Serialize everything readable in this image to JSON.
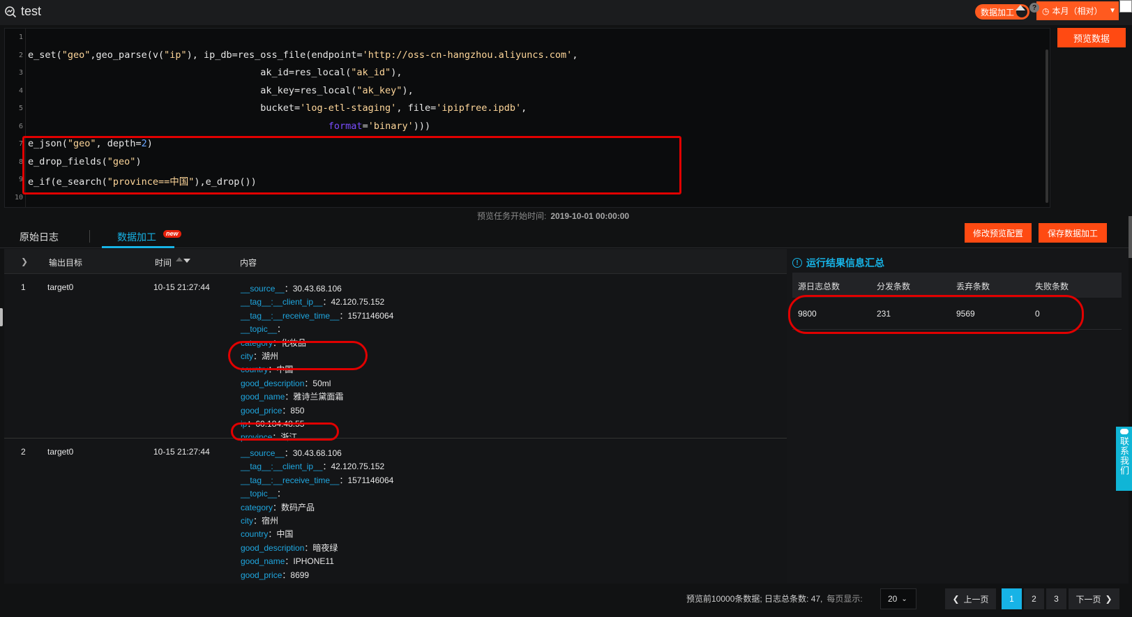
{
  "app": {
    "title": "test"
  },
  "header": {
    "toggle_label": "数据加工",
    "time_range": "本月（相对）",
    "preview_button": "预览数据"
  },
  "editor": {
    "lines": [
      {
        "n": "1",
        "html": ""
      },
      {
        "n": "2",
        "html": "e_set(<span class='str'>\"geo\"</span>,geo_parse(v(<span class='str'>\"ip\"</span>), ip_db=res_oss_file(endpoint=<span class='str'>'http://oss-cn-hangzhou.aliyuncs.com'</span>,"
      },
      {
        "n": "3",
        "html": "                                         ak_id=res_local(<span class='str'>\"ak_id\"</span>),"
      },
      {
        "n": "4",
        "html": "                                         ak_key=res_local(<span class='str'>\"ak_key\"</span>),"
      },
      {
        "n": "5",
        "html": "                                         bucket=<span class='str'>'log-etl-staging'</span>, file=<span class='str'>'ipipfree.ipdb'</span>,"
      },
      {
        "n": "6",
        "html": "                                                     <span class='kw'>format</span>=<span class='str'>'binary'</span>)))"
      },
      {
        "n": "7",
        "html": "e_json(<span class='str'>\"geo\"</span>, depth=<span class='num'>2</span>)"
      },
      {
        "n": "8",
        "html": "e_drop_fields(<span class='str'>\"geo\"</span>)"
      },
      {
        "n": "9",
        "html": "e_if(e_search(<span class='str'>\"province==中国\"</span>),e_drop())"
      },
      {
        "n": "10",
        "html": ""
      }
    ],
    "preview_time_label": "预览任务开始时间:",
    "preview_time_value": "2019-10-01 00:00:00"
  },
  "tabs": {
    "raw_log": "原始日志",
    "processing": "数据加工",
    "new_badge": "new",
    "modify_config": "修改预览配置",
    "save_processing": "保存数据加工"
  },
  "table": {
    "headers": {
      "target": "输出目标",
      "time": "时间",
      "content": "内容"
    },
    "rows": [
      {
        "index": "1",
        "target": "target0",
        "time": "10-15 21:27:44",
        "fields": [
          {
            "k": "__source__",
            "v": "30.43.68.106"
          },
          {
            "k": "__tag__:__client_ip__",
            "v": "42.120.75.152"
          },
          {
            "k": "__tag__:__receive_time__",
            "v": "1571146064"
          },
          {
            "k": "__topic__",
            "v": ""
          },
          {
            "k": "category",
            "v": "化妆品"
          },
          {
            "k": "city",
            "v": "湖州"
          },
          {
            "k": "country",
            "v": "中国"
          },
          {
            "k": "good_description",
            "v": "50ml"
          },
          {
            "k": "good_name",
            "v": "雅诗兰黛面霜"
          },
          {
            "k": "good_price",
            "v": "850"
          },
          {
            "k": "ip",
            "v": "60.184.48.55"
          },
          {
            "k": "province",
            "v": "浙江"
          }
        ]
      },
      {
        "index": "2",
        "target": "target0",
        "time": "10-15 21:27:44",
        "fields": [
          {
            "k": "__source__",
            "v": "30.43.68.106"
          },
          {
            "k": "__tag__:__client_ip__",
            "v": "42.120.75.152"
          },
          {
            "k": "__tag__:__receive_time__",
            "v": "1571146064"
          },
          {
            "k": "__topic__",
            "v": ""
          },
          {
            "k": "category",
            "v": "数码产品"
          },
          {
            "k": "city",
            "v": "宿州"
          },
          {
            "k": "country",
            "v": "中国"
          },
          {
            "k": "good_description",
            "v": "暗夜绿"
          },
          {
            "k": "good_name",
            "v": "IPHONE11"
          },
          {
            "k": "good_price",
            "v": "8699"
          }
        ]
      }
    ]
  },
  "summary": {
    "title": "运行结果信息汇总",
    "headers": [
      "源日志总数",
      "分发条数",
      "丢弃条数",
      "失败条数"
    ],
    "values": [
      "9800",
      "231",
      "9569",
      "0"
    ]
  },
  "contact": "联系我们",
  "pagination": {
    "info": "预览前10000条数据; 日志总条数: 47,",
    "per_page_label": "每页显示:",
    "page_size": "20",
    "prev": "上一页",
    "next": "下一页",
    "pages": [
      "1",
      "2",
      "3"
    ],
    "current": "1"
  }
}
